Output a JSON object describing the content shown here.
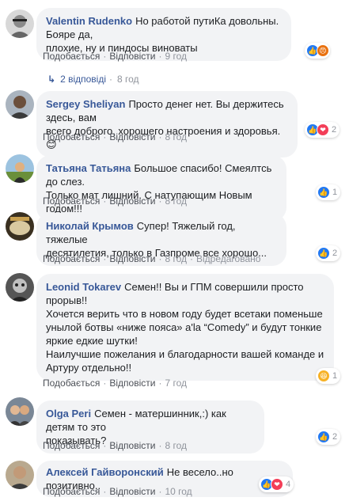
{
  "actions": {
    "like": "Подобається",
    "reply": "Відповісти",
    "edited": "Відредаговано"
  },
  "comments": [
    {
      "author": "Valentin Rudenko",
      "text": "Но работой путиКа довольны. Бояре да,\nплохие, ну и пиндосы виноваты",
      "time": "9 год",
      "reactions": {
        "types": [
          "like-icon",
          "angry-icon"
        ],
        "count": ""
      },
      "replies": {
        "label": "2 відповіді",
        "time": "8 год"
      }
    },
    {
      "author": "Sergey Sheliyan",
      "text": "Просто денег нет. Вы держитесь здесь, вам\nвсего доброго, хорошего настроения и здоровья. 😊",
      "time": "8 год",
      "reactions": {
        "types": [
          "like-icon",
          "love-icon"
        ],
        "count": "2"
      }
    },
    {
      "author": "Татьяна Татьяна",
      "text": "Большое спасибо! Смеялтсь до слез.\nТолько мат лишний. С натупающим Новым годом!!!",
      "time": "8 год",
      "reactions": {
        "types": [
          "like-icon"
        ],
        "count": "1"
      }
    },
    {
      "author": "Николай Крымов",
      "text": "Супер! Тяжелый год, тяжелые\nдесятилетия, только в Газпроме все хорошо...",
      "time": "8 год",
      "edited": true,
      "reactions": {
        "types": [
          "like-icon"
        ],
        "count": "2"
      }
    },
    {
      "author": "Leonid Tokarev",
      "text": "Семен!! Вы и ГПМ совершили просто\nпрорыв!!\nХочется верить что в новом году будет всетаки поменьше\nунылой ботвы «ниже пояса» a'la “Comedy” и будут тонкие\nяркие едкие шутки!\nНаилучшие пожелания и благодарности вашей команде и\nАртуру отдельно!!",
      "time": "7 год",
      "reactions": {
        "types": [
          "haha-icon"
        ],
        "count": "1"
      }
    },
    {
      "author": "Olga Peri",
      "text": "Семен - матершинник,:) как детям то это\nпоказывать?",
      "time": "8 год",
      "reactions": {
        "types": [
          "like-icon"
        ],
        "count": "2"
      }
    },
    {
      "author": "Алексей Гайворонский",
      "text": "Не весело..но позитивно..",
      "time": "10 год",
      "reactions": {
        "types": [
          "like-icon",
          "love-icon"
        ],
        "count": "4"
      }
    }
  ],
  "colors": {
    "author": "#385898",
    "bubble": "#f2f3f5",
    "like": "#2078f4",
    "love": "#f33e58"
  }
}
